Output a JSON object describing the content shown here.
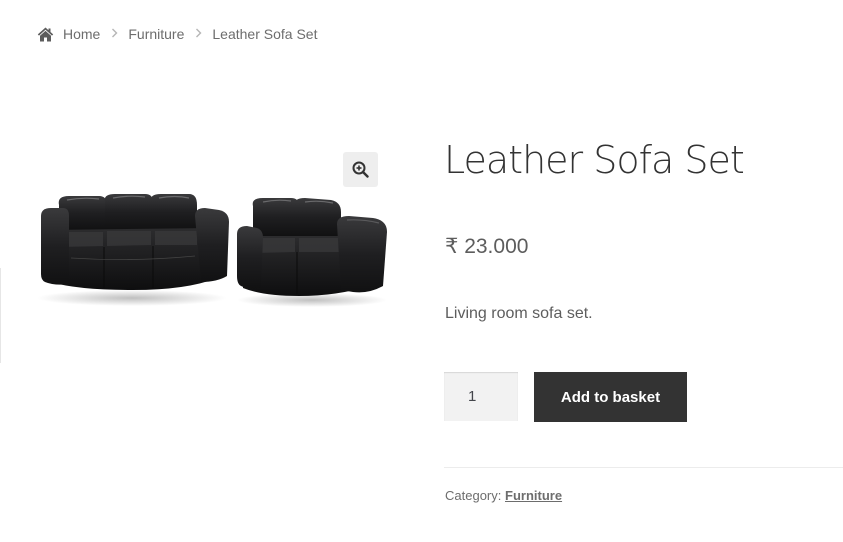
{
  "breadcrumb": {
    "icon": "home-icon",
    "items": [
      {
        "label": "Home"
      },
      {
        "label": "Furniture"
      }
    ],
    "current": "Leather Sofa Set",
    "separator_icon": "chevron-right-icon"
  },
  "gallery": {
    "image": "leather-sofa-set-image",
    "zoom_icon": "zoom-in-icon"
  },
  "product": {
    "title": "Leather Sofa Set",
    "price": "₹ 23.000",
    "short_description": "Living room sofa set.",
    "quantity": "1",
    "add_to_basket_label": "Add to basket",
    "meta": {
      "category_label": "Category:",
      "category_value": "Furniture"
    }
  },
  "colors": {
    "button_bg": "#333333",
    "button_text": "#ffffff",
    "input_bg": "#f2f2f2",
    "zoom_bg": "#eeeeee",
    "text": "#5d5d5d"
  }
}
